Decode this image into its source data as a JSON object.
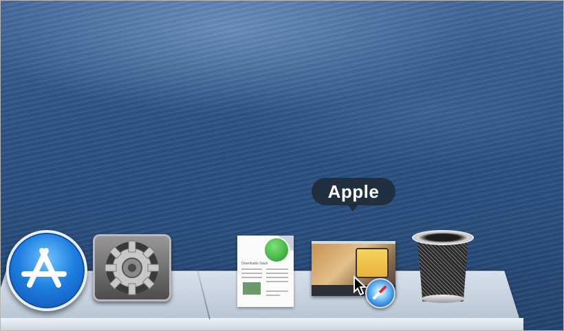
{
  "tooltip": {
    "text": "Apple"
  },
  "dock": {
    "items": [
      {
        "name": "App Store",
        "icon": "app-store-icon"
      },
      {
        "name": "System Preferences",
        "icon": "gear-icon"
      },
      {
        "name": "Document",
        "icon": "document-icon",
        "doc_title": "Downloads Stack"
      },
      {
        "name": "Safari window",
        "icon": "safari-icon"
      },
      {
        "name": "Trash",
        "icon": "trash-icon"
      }
    ]
  },
  "colors": {
    "accent": "#1f7fe0",
    "tooltip_bg": "#1e2832"
  }
}
